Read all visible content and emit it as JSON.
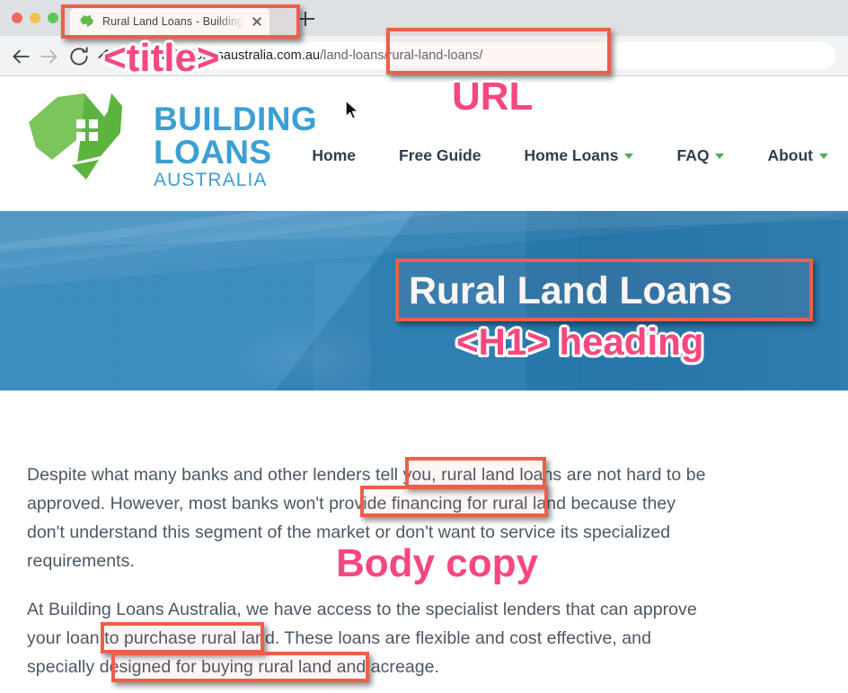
{
  "browser": {
    "traffic_lights": [
      "close",
      "minimize",
      "zoom"
    ],
    "tab": {
      "title": "Rural Land Loans - Building Loa",
      "favicon": "australia-map-favicon",
      "close_label": "×"
    },
    "new_tab_label": "+",
    "toolbar": {
      "back_icon": "back-arrow-icon",
      "forward_icon": "forward-arrow-icon",
      "reload_icon": "reload-icon",
      "home_icon": "home-icon"
    },
    "url": {
      "prefix": "w ",
      "host": "buildingloansaustralia.com.au",
      "path": "/land-loans/rural-land-loans/",
      "full": "w buildingloansaustralia.com.au/land-loans/rural-land-loans/"
    }
  },
  "site": {
    "logo": {
      "line1": "BUILDING",
      "line2": "LOANS",
      "line3": "AUSTRALIA",
      "mark": "australia-house-logo-mark",
      "text_color": "#3b9fd4",
      "mark_color": "#6cc04a"
    },
    "nav": [
      {
        "label": "Home",
        "has_dropdown": false
      },
      {
        "label": "Free Guide",
        "has_dropdown": false
      },
      {
        "label": "Home Loans",
        "has_dropdown": true
      },
      {
        "label": "FAQ",
        "has_dropdown": true
      },
      {
        "label": "About",
        "has_dropdown": true
      }
    ],
    "hero": {
      "heading": "Rural Land Loans",
      "bg_color": "#2980b9"
    },
    "content": {
      "paragraph1": "Despite what many banks and other lenders tell you, rural land loans are not hard to be approved. However, most banks won't provide financing for rural land because they don't understand this segment of the market or don't want to service its specialized requirements.",
      "paragraph2": "At Building Loans Australia, we have access to the specialist lenders that can approve your loan to purchase rural land. These loans are flexible and cost effective, and specially designed for buying rural land and acreage."
    }
  },
  "annotations": {
    "accent_box_color": "#ec5f4a",
    "accent_label_color": "#f7477f",
    "labels": [
      {
        "text": "<title>",
        "size": 42
      },
      {
        "text": "URL",
        "size": 42
      },
      {
        "text": "<H1> heading",
        "size": 42
      },
      {
        "text": "Body copy",
        "size": 42
      }
    ],
    "highlighted_phrases": [
      "rural land loans",
      "e financing for rural land",
      "o purchase rural land",
      "r buying rural land and acreage."
    ]
  }
}
